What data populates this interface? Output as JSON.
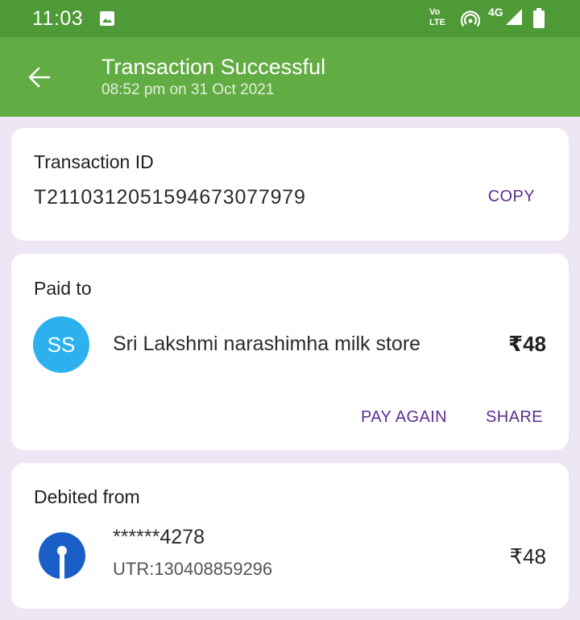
{
  "status_bar": {
    "time": "11:03",
    "volte_top": "Vo",
    "volte_bottom": "LTE",
    "network": "4G",
    "icons": [
      "image-icon",
      "hotspot-icon",
      "signal-icon",
      "battery-icon"
    ]
  },
  "app_bar": {
    "title": "Transaction Successful",
    "subtitle": "08:52 pm on 31 Oct 2021",
    "back_icon": "arrow-left-icon"
  },
  "transaction": {
    "label": "Transaction ID",
    "id": "T2110312051594673077979",
    "copy_label": "COPY"
  },
  "paid_to": {
    "label": "Paid to",
    "avatar_initials": "SS",
    "name": "Sri Lakshmi narashimha milk store",
    "amount": "₹48",
    "pay_again_label": "PAY AGAIN",
    "share_label": "SHARE"
  },
  "debited_from": {
    "label": "Debited from",
    "account": "******4278",
    "utr": "UTR:130408859296",
    "amount": "₹48",
    "bank_icon": "sbi-logo-icon"
  },
  "colors": {
    "status_bar": "#4e9a36",
    "app_bar": "#62ac44",
    "background": "#ede7f5",
    "accent": "#5c2d91",
    "avatar": "#2db1ee",
    "bank_logo": "#1a5fc8"
  }
}
